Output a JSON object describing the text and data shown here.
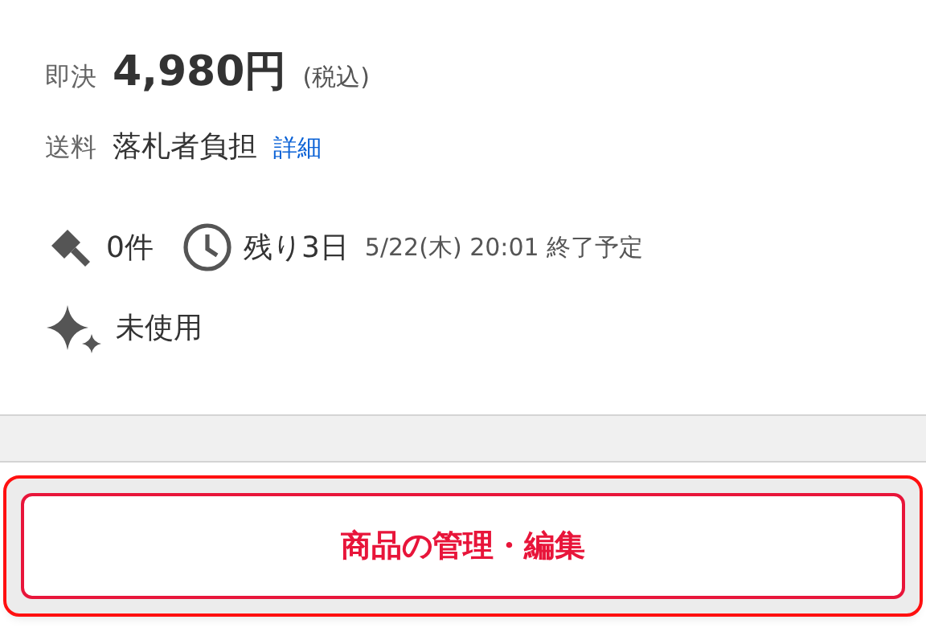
{
  "price": {
    "label": "即決",
    "amount": "4,980円",
    "tax_note": "(税込)"
  },
  "shipping": {
    "label": "送料",
    "value": "落札者負担",
    "link": "詳細"
  },
  "stats": [
    {
      "kind": "bids",
      "text": "0件"
    },
    {
      "kind": "time",
      "text": "残り3日",
      "detail": "5/22(木) 20:01 終了予定"
    }
  ],
  "condition": {
    "text": "未使用"
  },
  "manage_button": {
    "label": "商品の管理・編集",
    "focused": true
  }
}
